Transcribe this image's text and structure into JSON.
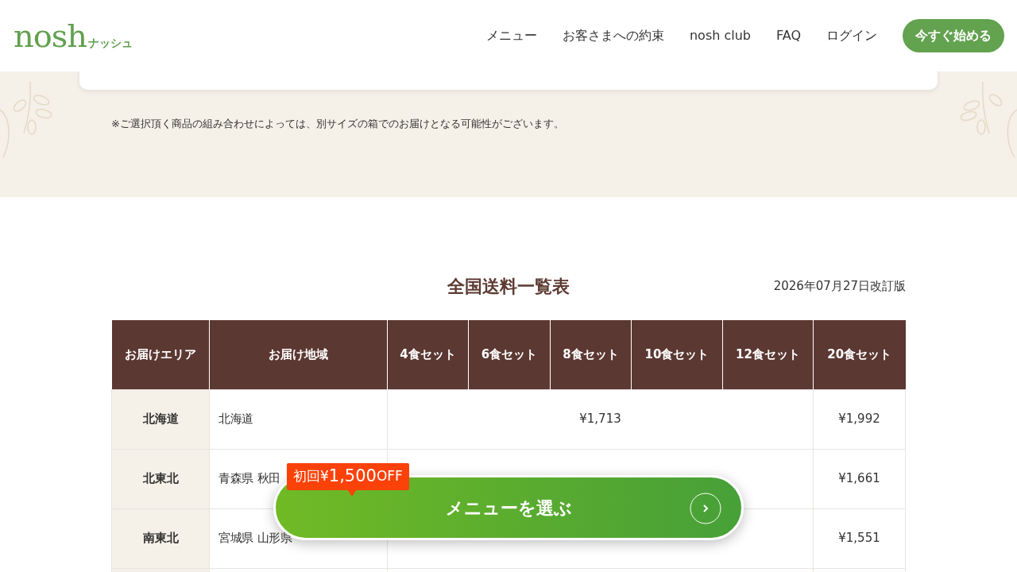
{
  "header": {
    "logo": {
      "text": "nosh",
      "sub": "ナッシュ"
    },
    "nav": [
      "メニュー",
      "お客さまへの約束",
      "nosh club",
      "FAQ",
      "ログイン"
    ],
    "cta": "今すぐ始める"
  },
  "notice": "※ご選択頂く商品の組み合わせによっては、別サイズの箱でのお届けとなる可能性がございます。",
  "table": {
    "title": "全国送料一覧表",
    "revised": "2026年07月27日改訂版",
    "columns": [
      "お届けエリア",
      "お届け地域",
      "4食セット",
      "6食セット",
      "8食セット",
      "10食セット",
      "12食セット",
      "20食セット"
    ],
    "rows": [
      {
        "area": "北海道",
        "regions": "北海道",
        "price_common": "¥1,713",
        "price_20": "¥1,992"
      },
      {
        "area": "北東北",
        "regions": "青森県 秋田",
        "price_20": "¥1,661"
      },
      {
        "area": "南東北",
        "regions": "宮城県 山形県",
        "price_20": "¥1,551"
      }
    ]
  },
  "floating_cta": {
    "badge": {
      "prefix": "初回¥",
      "amount": "1,500",
      "suffix": "OFF"
    },
    "label": "メニューを選ぶ"
  }
}
